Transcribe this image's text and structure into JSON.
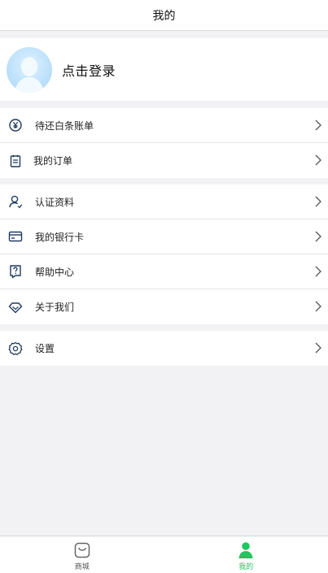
{
  "header": {
    "title": "我的"
  },
  "profile": {
    "login_label": "点击登录"
  },
  "menu_groups": [
    {
      "items": [
        {
          "label": "待还白条账单",
          "icon": "yen-circle-icon"
        },
        {
          "label": "我的订单",
          "icon": "order-icon"
        }
      ]
    },
    {
      "items": [
        {
          "label": "认证资料",
          "icon": "user-verify-icon"
        },
        {
          "label": "我的银行卡",
          "icon": "bank-card-icon"
        },
        {
          "label": "帮助中心",
          "icon": "help-icon"
        },
        {
          "label": "关于我们",
          "icon": "diamond-icon"
        }
      ]
    },
    {
      "items": [
        {
          "label": "设置",
          "icon": "gear-icon"
        }
      ]
    }
  ],
  "tabbar": {
    "tabs": [
      {
        "label": "商城",
        "icon": "shopping-bag-icon",
        "active": false
      },
      {
        "label": "我的",
        "icon": "person-icon",
        "active": true
      }
    ]
  },
  "colors": {
    "accent": "#22c55e",
    "icon": "#1f3a5f",
    "background": "#f2f2f5"
  }
}
